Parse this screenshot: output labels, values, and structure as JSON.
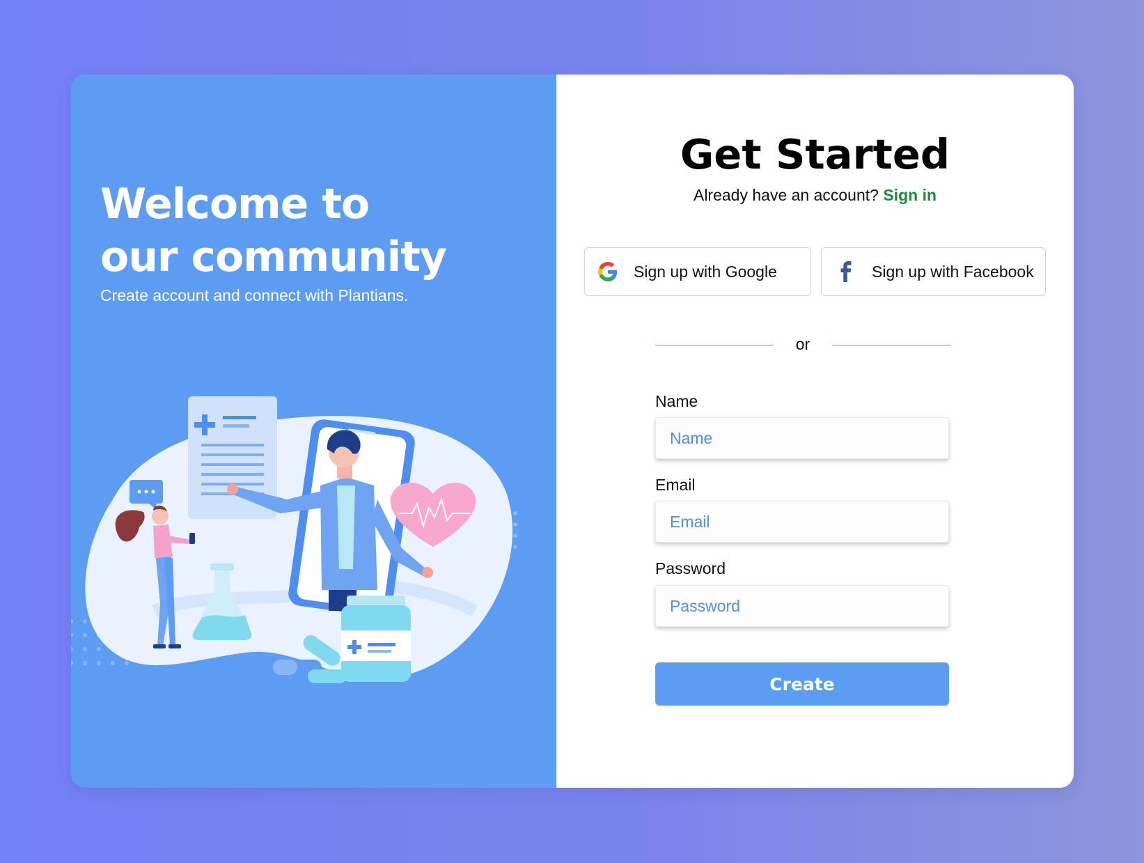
{
  "left": {
    "title_line1": "Welcome to",
    "title_line2": "our community",
    "subtitle": "Create account and connect with Plantians."
  },
  "right": {
    "heading": "Get Started",
    "have_account": "Already have an account?",
    "signin_link": "Sign in",
    "google_button": "Sign up with Google",
    "facebook_button": "Sign up with Facebook",
    "divider": "or",
    "name_label": "Name",
    "name_placeholder": "Name",
    "email_label": "Email",
    "email_placeholder": "Email",
    "password_label": "Password",
    "password_placeholder": "Password",
    "create_button": "Create"
  },
  "colors": {
    "background": "#7480f5",
    "panel_blue": "#5c9cf3",
    "link_green": "#1b8a3b",
    "facebook_blue": "#3b5998"
  },
  "icons": {
    "google": "google-icon",
    "facebook": "facebook-icon"
  }
}
